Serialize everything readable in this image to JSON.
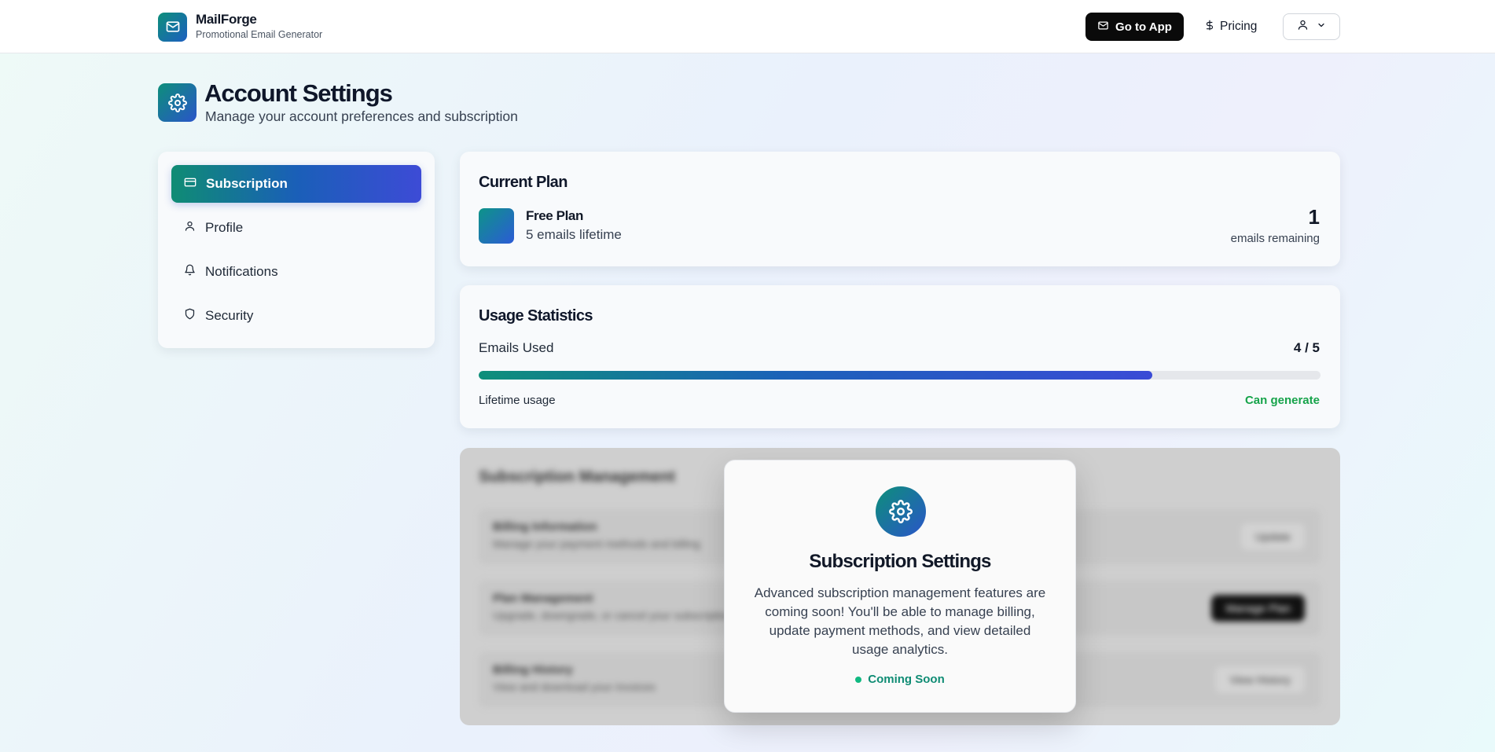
{
  "brand": {
    "name": "MailForge",
    "subtitle": "Promotional Email Generator"
  },
  "header": {
    "go_to_app": "Go to App",
    "pricing": "Pricing"
  },
  "page": {
    "title": "Account Settings",
    "subtitle": "Manage your account preferences and subscription"
  },
  "sidebar": {
    "items": [
      {
        "label": "Subscription",
        "icon": "credit-card-icon",
        "active": true
      },
      {
        "label": "Profile",
        "icon": "user-icon",
        "active": false
      },
      {
        "label": "Notifications",
        "icon": "bell-icon",
        "active": false
      },
      {
        "label": "Security",
        "icon": "shield-icon",
        "active": false
      }
    ]
  },
  "current_plan": {
    "title": "Current Plan",
    "plan_name": "Free Plan",
    "plan_desc": "5 emails lifetime",
    "remaining": "1",
    "remaining_label": "emails remaining"
  },
  "usage": {
    "title": "Usage Statistics",
    "label": "Emails Used",
    "value": "4 / 5",
    "progress_fraction": 0.8,
    "lifetime_label": "Lifetime usage",
    "status": "Can generate"
  },
  "management": {
    "title": "Subscription Management",
    "rows": [
      {
        "title": "Billing Information",
        "desc": "Manage your payment methods and billing",
        "button": "Update"
      },
      {
        "title": "Plan Management",
        "desc": "Upgrade, downgrade, or cancel your subscription",
        "button": "Manage Plan"
      },
      {
        "title": "Billing History",
        "desc": "View and download your invoices",
        "button": "View History"
      }
    ]
  },
  "modal": {
    "title": "Subscription Settings",
    "body": "Advanced subscription management features are coming soon! You'll be able to manage billing, update payment methods, and view detailed usage analytics.",
    "status": "Coming Soon"
  },
  "colors": {
    "accent_teal": "#0f8c74",
    "accent_indigo": "#3d4bd6",
    "success_green": "#16a34a",
    "primary_dark": "#0a0a0a"
  }
}
